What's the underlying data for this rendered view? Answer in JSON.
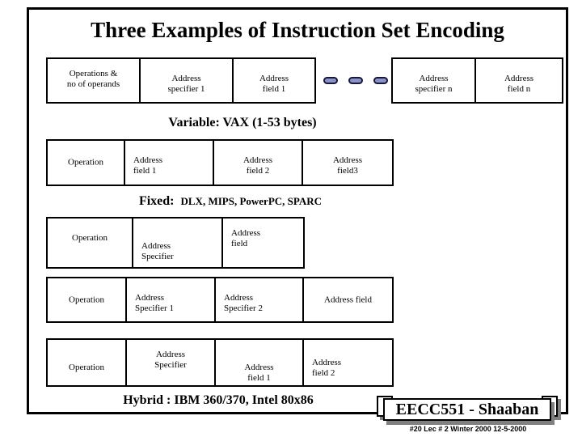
{
  "slide": {
    "title": "Three Examples of Instruction Set Encoding"
  },
  "captions": {
    "variable": "Variable: VAX  (1-53 bytes)",
    "fixed_label": "Fixed:",
    "fixed_archs": "DLX, MIPS, PowerPC, SPARC",
    "hybrid": "Hybrid : IBM 360/370,  Intel 80x86"
  },
  "ellipsis": {
    "icon": "capsule-dots",
    "count": 3
  },
  "rows": {
    "variable_left": [
      {
        "line1": "Operations &",
        "line2": "no of operands"
      },
      {
        "line1": "Address",
        "line2": "specifier 1"
      },
      {
        "line1": "Address",
        "line2": "field 1"
      }
    ],
    "variable_right": [
      {
        "line1": "Address",
        "line2": "specifier n"
      },
      {
        "line1": "Address",
        "line2": "field n"
      }
    ],
    "fixed": [
      {
        "line1": "Operation",
        "line2": ""
      },
      {
        "line1": "Address",
        "line2": "field 1"
      },
      {
        "line1": "Address",
        "line2": "field 2"
      },
      {
        "line1": "Address",
        "line2": "field3"
      }
    ],
    "hybrid_a": [
      {
        "line1": "Operation",
        "line2": ""
      },
      {
        "line1": "Address",
        "line2": "Specifier"
      },
      {
        "line1": "Address",
        "line2": "field"
      }
    ],
    "hybrid_b": [
      {
        "line1": "Operation",
        "line2": ""
      },
      {
        "line1": "Address",
        "line2": "Specifier 1"
      },
      {
        "line1": "Address",
        "line2": "Specifier 2"
      },
      {
        "line1": "Address field",
        "line2": ""
      }
    ],
    "hybrid_c": [
      {
        "line1": "Operation",
        "line2": ""
      },
      {
        "line1": "Address",
        "line2": "Specifier"
      },
      {
        "line1": "Address",
        "line2": "field 1"
      },
      {
        "line1": "Address",
        "line2": "field 2"
      }
    ]
  },
  "footer": {
    "badge": "EECC551 - Shaaban",
    "meta": "#20   Lec # 2   Winter 2000  12-5-2000"
  },
  "colors": {
    "border": "#000000",
    "capsule_fill": "#8d93c4",
    "capsule_border": "#16183c",
    "shadow": "#808080",
    "background": "#ffffff"
  }
}
